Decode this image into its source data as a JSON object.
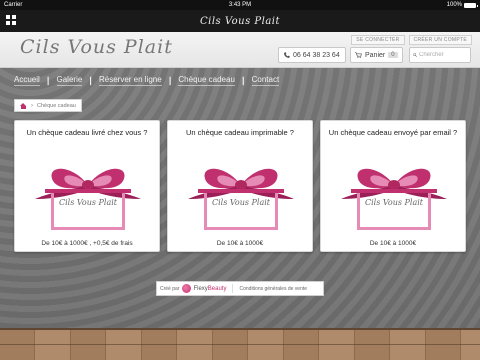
{
  "status_bar": {
    "carrier": "Carrier",
    "time": "3:43 PM",
    "battery": "100%"
  },
  "app_bar": {
    "title": "Cils Vous Plait"
  },
  "header": {
    "logo": "Cils Vous Plait",
    "login_link": "SE CONNECTER",
    "signup_link": "CRÉER UN COMPTE",
    "phone": "06 64 38 23 64",
    "cart_label": "Panier",
    "cart_count": "0",
    "search_placeholder": "Chercher"
  },
  "nav": {
    "items": [
      {
        "label": "Accueil"
      },
      {
        "label": "Galerie"
      },
      {
        "label": "Réserver en ligne"
      },
      {
        "label": "Chèque cadeau"
      },
      {
        "label": "Contact"
      }
    ]
  },
  "breadcrumb": {
    "current": "Chèque cadeau"
  },
  "cards": [
    {
      "title": "Un chèque cadeau livré chez vous ?",
      "gift_text": "Cils Vous Plait",
      "price": "De 10€ à 1000€ , +0,5€ de frais"
    },
    {
      "title": "Un chèque cadeau imprimable ?",
      "gift_text": "Cils Vous Plait",
      "price": "De 10€ à 1000€"
    },
    {
      "title": "Un chèque cadeau envoyé par email ?",
      "gift_text": "Cils Vous Plait",
      "price": "De 10€ à 1000€"
    }
  ],
  "footer": {
    "created_by": "Créé par",
    "brand_prefix": "Flexy",
    "brand_suffix": "Beauty",
    "terms": "Conditions générales de vente"
  },
  "colors": {
    "brand_pink": "#c0306f",
    "ribbon_light": "#e58bb5",
    "ribbon_dark": "#9b1f58"
  },
  "icons": [
    "wifi-icon",
    "battery-icon",
    "grid-icon",
    "phone-icon",
    "cart-icon",
    "search-icon",
    "home-icon",
    "gift-bow-icon"
  ]
}
